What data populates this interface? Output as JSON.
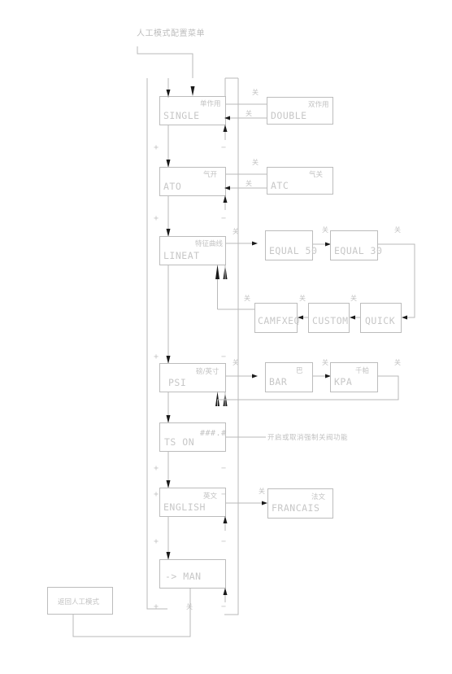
{
  "diagram": {
    "title": "人工模式配置菜单",
    "return_label": "返回人工模式",
    "note_ts": "开启或取消强制关阀功能",
    "sign_plus": "+",
    "sign_minus": "−",
    "toggle_label": "关",
    "ts_value": "###.#"
  },
  "main_column": [
    {
      "id": "single",
      "code": "SINGLE",
      "cn": "单作用"
    },
    {
      "id": "ato",
      "code": "ATO",
      "cn": "气开"
    },
    {
      "id": "lineat",
      "code": "LINEAT",
      "cn": "特征曲线"
    },
    {
      "id": "psi",
      "code": "PSI",
      "cn": "磅/英寸"
    },
    {
      "id": "tson",
      "code": "TS ON",
      "cn": "###.#"
    },
    {
      "id": "english",
      "code": "ENGLISH",
      "cn": "英文"
    },
    {
      "id": "man",
      "code": "-> MAN",
      "cn": ""
    }
  ],
  "branches": {
    "single": [
      {
        "code": "DOUBLE",
        "cn": "双作用"
      }
    ],
    "ato": [
      {
        "code": "ATC",
        "cn": "气关"
      }
    ],
    "lineat": [
      {
        "code": "EQUAL 50",
        "cn": ""
      },
      {
        "code": "EQUAL 30",
        "cn": ""
      },
      {
        "code": "QUICK",
        "cn": ""
      },
      {
        "code": "CUSTOM",
        "cn": ""
      },
      {
        "code": "CAMFXEQ",
        "cn": ""
      }
    ],
    "psi": [
      {
        "code": "BAR",
        "cn": "巴"
      },
      {
        "code": "KPA",
        "cn": "千帕"
      }
    ],
    "english": [
      {
        "code": "FRANCAIS",
        "cn": "法文"
      }
    ]
  },
  "colors": {
    "line": "#b9b9b9",
    "box": "#bcbcbc",
    "text": "#c7c7c7",
    "arrow": "#1a1a1a",
    "background": "#ffffff"
  },
  "icons": {
    "arrow_down": "arrow-down-icon",
    "arrow_right": "arrow-right-icon",
    "arrow_left": "arrow-left-icon",
    "arrow_up": "arrow-up-icon"
  }
}
